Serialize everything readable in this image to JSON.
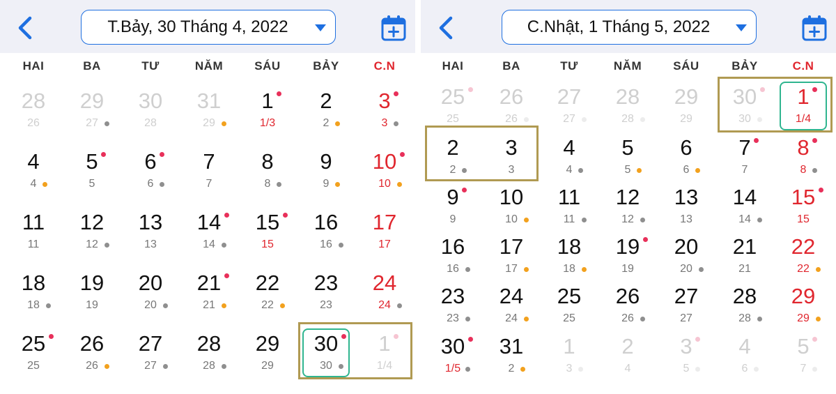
{
  "colors": {
    "header_bg": "#eff0f7",
    "accent": "#1e6fe0",
    "sunday": "#e0262e",
    "today_border": "#2fb58f",
    "highlight_border": "#b09a52",
    "dot_red": "#e8305a",
    "dot_orange": "#f2a11e",
    "dot_gray": "#8f8f8f"
  },
  "panels": [
    {
      "title": "T.Bảy, 30 Tháng 4, 2022",
      "back_icon": "chevron-left-icon",
      "dropdown_icon": "caret-down-icon",
      "add_icon": "calendar-plus-icon",
      "weekdays": [
        "HAI",
        "BA",
        "TƯ",
        "NĂM",
        "SÁU",
        "BẢY",
        "C.N"
      ],
      "weeks": [
        [
          {
            "solar": "28",
            "lunar": "26",
            "other": true
          },
          {
            "solar": "29",
            "lunar": "27",
            "other": true,
            "ldot": "gray"
          },
          {
            "solar": "30",
            "lunar": "28",
            "other": true
          },
          {
            "solar": "31",
            "lunar": "29",
            "other": true,
            "ldot": "orange"
          },
          {
            "solar": "1",
            "lunar": "1/3",
            "sdot": "red",
            "lunar_first": true
          },
          {
            "solar": "2",
            "lunar": "2",
            "ldot": "orange"
          },
          {
            "solar": "3",
            "lunar": "3",
            "sdot": "red",
            "ldot": "gray"
          }
        ],
        [
          {
            "solar": "4",
            "lunar": "4",
            "ldot": "orange"
          },
          {
            "solar": "5",
            "lunar": "5",
            "sdot": "red"
          },
          {
            "solar": "6",
            "lunar": "6",
            "sdot": "red",
            "ldot": "gray"
          },
          {
            "solar": "7",
            "lunar": "7"
          },
          {
            "solar": "8",
            "lunar": "8",
            "ldot": "gray"
          },
          {
            "solar": "9",
            "lunar": "9",
            "ldot": "orange"
          },
          {
            "solar": "10",
            "lunar": "10",
            "sdot": "red",
            "ldot": "orange"
          }
        ],
        [
          {
            "solar": "11",
            "lunar": "11"
          },
          {
            "solar": "12",
            "lunar": "12",
            "ldot": "gray"
          },
          {
            "solar": "13",
            "lunar": "13"
          },
          {
            "solar": "14",
            "lunar": "14",
            "sdot": "red",
            "ldot": "gray"
          },
          {
            "solar": "15",
            "lunar": "15",
            "sdot": "red",
            "lunar_first": true
          },
          {
            "solar": "16",
            "lunar": "16",
            "ldot": "gray"
          },
          {
            "solar": "17",
            "lunar": "17"
          }
        ],
        [
          {
            "solar": "18",
            "lunar": "18",
            "ldot": "gray"
          },
          {
            "solar": "19",
            "lunar": "19"
          },
          {
            "solar": "20",
            "lunar": "20",
            "ldot": "gray"
          },
          {
            "solar": "21",
            "lunar": "21",
            "sdot": "red",
            "ldot": "orange"
          },
          {
            "solar": "22",
            "lunar": "22",
            "ldot": "orange"
          },
          {
            "solar": "23",
            "lunar": "23"
          },
          {
            "solar": "24",
            "lunar": "24",
            "ldot": "gray"
          }
        ],
        [
          {
            "solar": "25",
            "lunar": "25",
            "sdot": "red"
          },
          {
            "solar": "26",
            "lunar": "26",
            "ldot": "orange"
          },
          {
            "solar": "27",
            "lunar": "27",
            "ldot": "gray"
          },
          {
            "solar": "28",
            "lunar": "28",
            "ldot": "gray"
          },
          {
            "solar": "29",
            "lunar": "29"
          },
          {
            "solar": "30",
            "lunar": "30",
            "sdot": "red",
            "ldot": "gray",
            "today": true
          },
          {
            "solar": "1",
            "lunar": "1/4",
            "other": true,
            "sdot": "pink"
          }
        ]
      ]
    },
    {
      "title": "C.Nhật, 1 Tháng 5, 2022",
      "back_icon": "chevron-left-icon",
      "dropdown_icon": "caret-down-icon",
      "add_icon": "calendar-plus-icon",
      "weekdays": [
        "HAI",
        "BA",
        "TƯ",
        "NĂM",
        "SÁU",
        "BẢY",
        "C.N"
      ],
      "weeks": [
        [
          {
            "solar": "25",
            "lunar": "25",
            "other": true,
            "sdot": "pink"
          },
          {
            "solar": "26",
            "lunar": "26",
            "other": true,
            "ldot": "pale"
          },
          {
            "solar": "27",
            "lunar": "27",
            "other": true,
            "ldot": "pale"
          },
          {
            "solar": "28",
            "lunar": "28",
            "other": true,
            "ldot": "pale"
          },
          {
            "solar": "29",
            "lunar": "29",
            "other": true
          },
          {
            "solar": "30",
            "lunar": "30",
            "other": true,
            "sdot": "pink",
            "ldot": "pale"
          },
          {
            "solar": "1",
            "lunar": "1/4",
            "sdot": "red",
            "lunar_first": true,
            "today": true
          }
        ],
        [
          {
            "solar": "2",
            "lunar": "2",
            "ldot": "gray"
          },
          {
            "solar": "3",
            "lunar": "3"
          },
          {
            "solar": "4",
            "lunar": "4",
            "ldot": "gray"
          },
          {
            "solar": "5",
            "lunar": "5",
            "ldot": "orange"
          },
          {
            "solar": "6",
            "lunar": "6",
            "ldot": "orange"
          },
          {
            "solar": "7",
            "lunar": "7",
            "sdot": "red"
          },
          {
            "solar": "8",
            "lunar": "8",
            "sdot": "red",
            "ldot": "gray"
          }
        ],
        [
          {
            "solar": "9",
            "lunar": "9",
            "sdot": "red"
          },
          {
            "solar": "10",
            "lunar": "10",
            "ldot": "orange"
          },
          {
            "solar": "11",
            "lunar": "11",
            "ldot": "gray"
          },
          {
            "solar": "12",
            "lunar": "12",
            "ldot": "gray"
          },
          {
            "solar": "13",
            "lunar": "13"
          },
          {
            "solar": "14",
            "lunar": "14",
            "ldot": "gray"
          },
          {
            "solar": "15",
            "lunar": "15",
            "sdot": "red"
          }
        ],
        [
          {
            "solar": "16",
            "lunar": "16",
            "ldot": "gray"
          },
          {
            "solar": "17",
            "lunar": "17",
            "ldot": "orange"
          },
          {
            "solar": "18",
            "lunar": "18",
            "ldot": "orange"
          },
          {
            "solar": "19",
            "lunar": "19",
            "sdot": "red"
          },
          {
            "solar": "20",
            "lunar": "20",
            "ldot": "gray"
          },
          {
            "solar": "21",
            "lunar": "21"
          },
          {
            "solar": "22",
            "lunar": "22",
            "ldot": "orange"
          }
        ],
        [
          {
            "solar": "23",
            "lunar": "23",
            "ldot": "gray"
          },
          {
            "solar": "24",
            "lunar": "24",
            "ldot": "orange"
          },
          {
            "solar": "25",
            "lunar": "25"
          },
          {
            "solar": "26",
            "lunar": "26",
            "ldot": "gray"
          },
          {
            "solar": "27",
            "lunar": "27"
          },
          {
            "solar": "28",
            "lunar": "28",
            "ldot": "gray"
          },
          {
            "solar": "29",
            "lunar": "29",
            "ldot": "orange"
          }
        ],
        [
          {
            "solar": "30",
            "lunar": "1/5",
            "sdot": "red",
            "ldot": "gray",
            "lunar_first": true
          },
          {
            "solar": "31",
            "lunar": "2",
            "ldot": "orange"
          },
          {
            "solar": "1",
            "lunar": "3",
            "other": true,
            "ldot": "pale"
          },
          {
            "solar": "2",
            "lunar": "4",
            "other": true
          },
          {
            "solar": "3",
            "lunar": "5",
            "other": true,
            "sdot": "pink",
            "ldot": "pale"
          },
          {
            "solar": "4",
            "lunar": "6",
            "other": true,
            "ldot": "pale"
          },
          {
            "solar": "5",
            "lunar": "7",
            "other": true,
            "sdot": "pink",
            "ldot": "pale"
          }
        ]
      ]
    }
  ]
}
